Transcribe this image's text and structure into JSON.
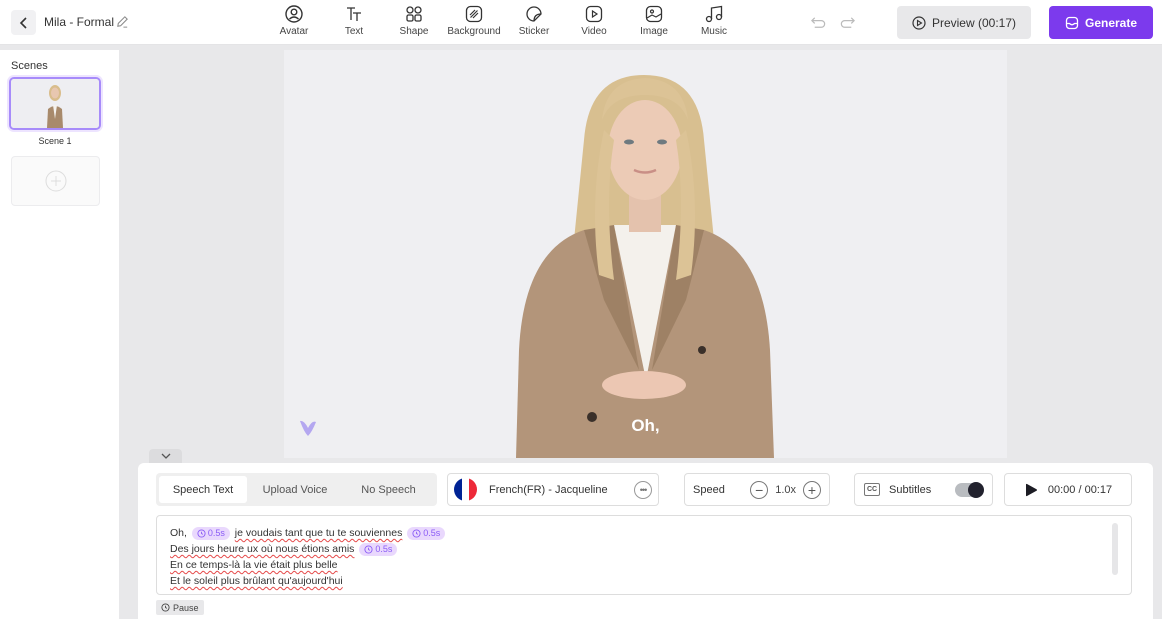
{
  "header": {
    "project_title": "Mila - Formal",
    "tools": [
      {
        "label": "Avatar",
        "icon": "avatar-icon"
      },
      {
        "label": "Text",
        "icon": "text-icon"
      },
      {
        "label": "Shape",
        "icon": "shape-icon"
      },
      {
        "label": "Background",
        "icon": "background-icon"
      },
      {
        "label": "Sticker",
        "icon": "sticker-icon"
      },
      {
        "label": "Video",
        "icon": "video-icon"
      },
      {
        "label": "Image",
        "icon": "image-icon"
      },
      {
        "label": "Music",
        "icon": "music-icon"
      }
    ],
    "preview_label": "Preview (00:17)",
    "generate_label": "Generate"
  },
  "sidebar": {
    "title": "Scenes",
    "scenes": [
      {
        "name": "Scene 1"
      }
    ]
  },
  "canvas": {
    "subtitle": "Oh,"
  },
  "speech": {
    "tabs": [
      {
        "label": "Speech Text",
        "active": true
      },
      {
        "label": "Upload Voice",
        "active": false
      },
      {
        "label": "No Speech",
        "active": false
      }
    ],
    "voice": "French(FR) - Jacqueline",
    "speed_label": "Speed",
    "speed_value": "1.0x",
    "subtitles_label": "Subtitles",
    "subtitles_on": true,
    "time": "00:00 / 00:17",
    "pause_chip": "0.5s",
    "lines": {
      "l1a": "Oh,",
      "l1b": "je voudais tant que tu te souviennes",
      "l2": "Des jours heure ux où nous étions amis",
      "l3": "En ce temps-là la vie était plus belle",
      "l4": "Et le soleil plus brûlant qu'aujourd'hui"
    },
    "pause_button": "Pause"
  },
  "colors": {
    "accent": "#7c3aed",
    "pause_chip_bg": "#e9d8fd",
    "flag_blue": "#002395",
    "flag_white": "#ffffff",
    "flag_red": "#ed2939"
  }
}
